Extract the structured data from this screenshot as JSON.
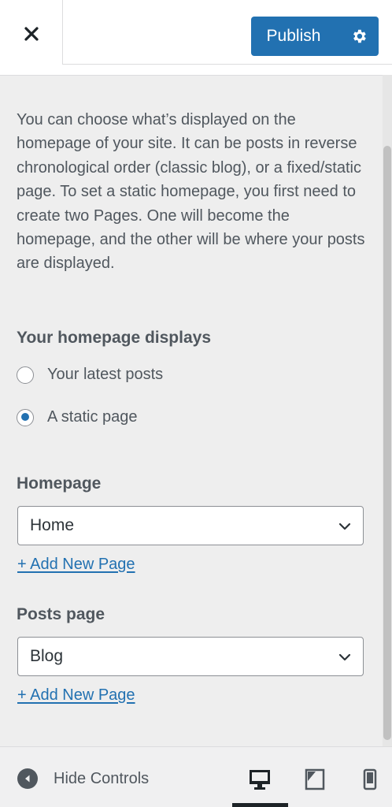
{
  "header": {
    "close_icon": "close-icon",
    "publish_label": "Publish",
    "settings_icon": "gear-icon",
    "accent": "#2271b1"
  },
  "description": "You can choose what’s displayed on the homepage of your site. It can be posts in reverse chronological order (classic blog), or a fixed/static page. To set a static homepage, you first need to create two Pages. One will become the homepage, and the other will be where your posts are displayed.",
  "homepage_displays": {
    "label": "Your homepage displays",
    "options": [
      {
        "label": "Your latest posts",
        "checked": false
      },
      {
        "label": "A static page",
        "checked": true
      }
    ]
  },
  "homepage": {
    "label": "Homepage",
    "selected": "Home",
    "add_link": "+ Add New Page"
  },
  "posts_page": {
    "label": "Posts page",
    "selected": "Blog",
    "add_link": "+ Add New Page"
  },
  "footer": {
    "hide_controls_label": "Hide Controls",
    "devices": [
      "desktop-icon",
      "tablet-icon",
      "mobile-icon"
    ],
    "active_device": "desktop"
  }
}
